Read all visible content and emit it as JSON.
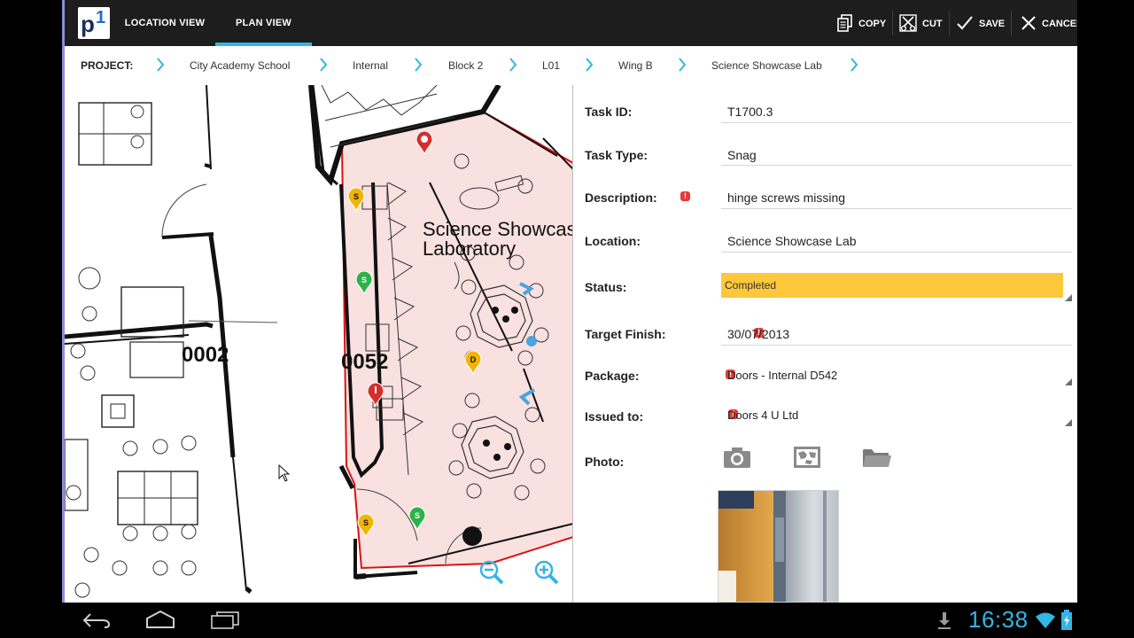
{
  "actionbar": {
    "logo_text": "p1",
    "tabs": [
      {
        "label": "LOCATION VIEW",
        "selected": false
      },
      {
        "label": "PLAN VIEW",
        "selected": true
      }
    ],
    "actions": {
      "copy": "COPY",
      "cut": "CUT",
      "save": "SAVE",
      "cancel": "CANCEL"
    }
  },
  "breadcrumb": {
    "lead": "PROJECT:",
    "items": [
      "City Academy School",
      "Internal",
      "Block 2",
      "L01",
      "Wing B",
      "Science Showcase Lab"
    ]
  },
  "plan": {
    "room_title_line1": "Science Showcase",
    "room_title_line2": "Laboratory",
    "room_numbers": [
      "0002",
      "0052"
    ],
    "pin_markers": [
      {
        "letter": "S",
        "color": "#f1b500"
      },
      {
        "letter": "S",
        "color": "#2db24a"
      },
      {
        "letter": "",
        "color": "#d32f2f"
      },
      {
        "letter": "",
        "color": "#d32f2f"
      },
      {
        "letter": "D",
        "color": "#f1b500"
      },
      {
        "letter": "S",
        "color": "#2db24a"
      },
      {
        "letter": "S",
        "color": "#f1b500"
      }
    ],
    "controls": [
      "zoom-out-icon",
      "zoom-in-icon"
    ]
  },
  "form": {
    "task_id": {
      "label": "Task ID:",
      "value": "T1700.3"
    },
    "task_type": {
      "label": "Task Type:",
      "value": "Snag"
    },
    "description": {
      "label": "Description:",
      "value": "hinge screws missing"
    },
    "location": {
      "label": "Location:",
      "value": "Science Showcase Lab"
    },
    "status": {
      "label": "Status:",
      "value": "Completed",
      "color": "#ffc83a"
    },
    "target_finish": {
      "label": "Target Finish:",
      "value": "30/07/2013"
    },
    "package": {
      "label": "Package:",
      "value": "Doors - Internal D542"
    },
    "issued_to": {
      "label": "Issued to:",
      "value": "Doors 4 U Ltd"
    },
    "photo": {
      "label": "Photo:",
      "icons": [
        "camera-icon",
        "map-photo-icon",
        "folder-icon"
      ]
    },
    "required_marker": "!"
  },
  "system": {
    "time": "16:38",
    "accent": "#33b5e5"
  }
}
